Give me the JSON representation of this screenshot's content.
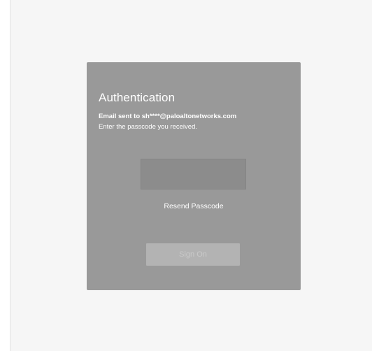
{
  "auth": {
    "title": "Authentication",
    "email_message": "Email sent to sh****@paloaltonetworks.com",
    "instruction": "Enter the passcode you received.",
    "passcode_value": "",
    "passcode_placeholder": "",
    "resend_label": "Resend Passcode",
    "signon_label": "Sign On"
  }
}
